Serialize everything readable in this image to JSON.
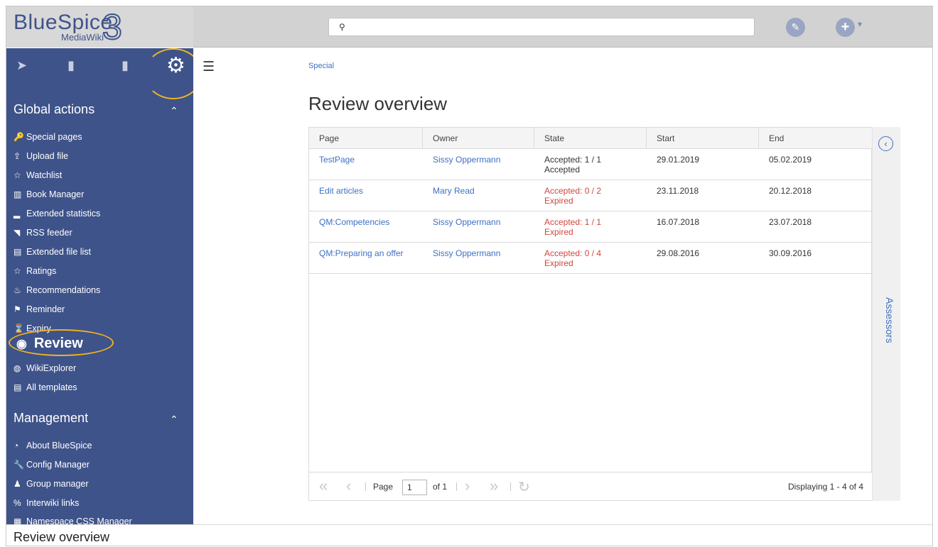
{
  "logo": {
    "brand": "BlueSpice",
    "version": "3",
    "subtitle": "MediaWiki"
  },
  "header": {
    "search_icon": "search-icon",
    "edit_icon": "pencil-icon",
    "new_icon": "plus-icon",
    "new_caret": "▾"
  },
  "sidebar": {
    "tabs": [
      {
        "icon": "navigation-icon",
        "glyph": "➤"
      },
      {
        "icon": "book-icon",
        "glyph": "▮"
      },
      {
        "icon": "clipboard-icon",
        "glyph": "▮"
      },
      {
        "icon": "gear-icon",
        "glyph": "⚙"
      }
    ],
    "global_actions": {
      "title": "Global actions",
      "caret": "⌃",
      "items": [
        {
          "label": "Special pages",
          "icon": "key-icon",
          "glyph": "🔑"
        },
        {
          "label": "Upload file",
          "icon": "upload-icon",
          "glyph": "⇪"
        },
        {
          "label": "Watchlist",
          "icon": "star-icon",
          "glyph": "☆"
        },
        {
          "label": "Book Manager",
          "icon": "books-icon",
          "glyph": "▥"
        },
        {
          "label": "Extended statistics",
          "icon": "chart-icon",
          "glyph": "▂"
        },
        {
          "label": "RSS feeder",
          "icon": "rss-icon",
          "glyph": "◥"
        },
        {
          "label": "Extended file list",
          "icon": "list-icon",
          "glyph": "▤"
        },
        {
          "label": "Ratings",
          "icon": "star-icon",
          "glyph": "☆"
        },
        {
          "label": "Recommendations",
          "icon": "flame-icon",
          "glyph": "♨"
        },
        {
          "label": "Reminder",
          "icon": "flag-icon",
          "glyph": "⚑"
        },
        {
          "label": "Expiry",
          "icon": "hourglass-icon",
          "glyph": "⌛"
        }
      ],
      "review": {
        "label": "Review",
        "icon": "eye-icon",
        "glyph": "◉"
      },
      "items_after": [
        {
          "label": "WikiExplorer",
          "icon": "globe-icon",
          "glyph": "◍"
        },
        {
          "label": "All templates",
          "icon": "list-icon",
          "glyph": "▤"
        }
      ]
    },
    "management": {
      "title": "Management",
      "caret": "⌃",
      "items": [
        {
          "label": "About BlueSpice",
          "icon": "dashboard-icon",
          "glyph": "◔"
        },
        {
          "label": "Config Manager",
          "icon": "wrench-icon",
          "glyph": "🔧"
        },
        {
          "label": "Group manager",
          "icon": "group-icon",
          "glyph": "♟"
        },
        {
          "label": "Interwiki links",
          "icon": "link-icon",
          "glyph": "%"
        },
        {
          "label": "Namespace CSS Manager",
          "icon": "brush-icon",
          "glyph": "▦"
        }
      ]
    }
  },
  "content": {
    "breadcrumb": "Special",
    "title": "Review overview",
    "columns": [
      "Page",
      "Owner",
      "State",
      "Start",
      "End"
    ],
    "rows": [
      {
        "page": "TestPage",
        "owner": "Sissy Oppermann",
        "state_line1": "Accepted: 1 / 1",
        "state_line2": "Accepted",
        "state_status": "accepted",
        "start": "29.01.2019",
        "end": "05.02.2019"
      },
      {
        "page": "Edit articles",
        "owner": "Mary Read",
        "state_line1": "Accepted: 0 / 2",
        "state_line2": "Expired",
        "state_status": "expired",
        "start": "23.11.2018",
        "end": "20.12.2018"
      },
      {
        "page": "QM:Competencies",
        "owner": "Sissy Oppermann",
        "state_line1": "Accepted: 1 / 1",
        "state_line2": "Expired",
        "state_status": "expired",
        "start": "16.07.2018",
        "end": "23.07.2018"
      },
      {
        "page": "QM:Preparing an offer",
        "owner": "Sissy Oppermann",
        "state_line1": "Accepted: 0 / 4",
        "state_line2": "Expired",
        "state_status": "expired",
        "start": "29.08.2016",
        "end": "30.09.2016"
      }
    ],
    "pager": {
      "page_label": "Page",
      "page_value": "1",
      "of_label": "of 1",
      "displaying": "Displaying 1 - 4 of 4"
    },
    "assessors_label": "Assessors"
  },
  "caption": "Review overview",
  "colors": {
    "sidebar_bg": "#3e5389",
    "link": "#3e70c2",
    "expired": "#d0463e",
    "highlight": "#f0b323"
  }
}
